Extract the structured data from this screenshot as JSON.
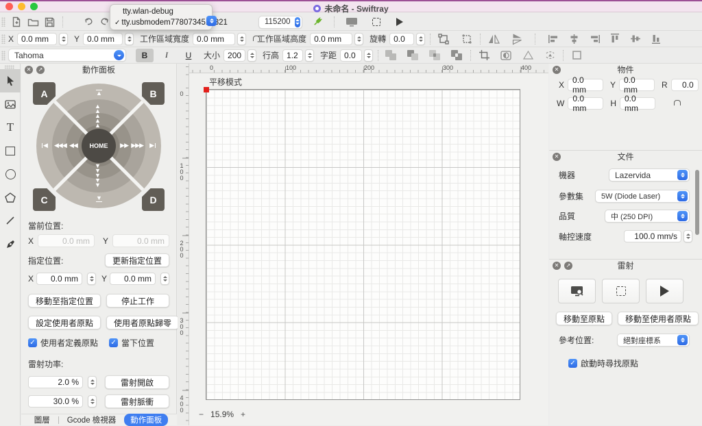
{
  "window": {
    "title": "未命名 - Swiftray"
  },
  "toolbar1": {
    "port_menu": {
      "item0": "tty.wlan-debug",
      "item1": "tty.usbmodem7780734518321",
      "check": "✓"
    },
    "baud": "115200"
  },
  "toolbar2": {
    "x_label": "X",
    "x_value": "0.0 mm",
    "y_label": "Y",
    "y_value": "0.0 mm",
    "width_label": "工作區域寬度",
    "width_value": "0.0 mm",
    "height_label": "工作區域高度",
    "height_value": "0.0 mm",
    "rotate_label": "旋轉",
    "rotate_value": "0.0"
  },
  "toolbar3": {
    "font_family": "Tahoma",
    "bold": "B",
    "italic": "I",
    "underline": "U",
    "size_label": "大小",
    "size_value": "200",
    "line_height_label": "行高",
    "line_height_value": "1.2",
    "letter_spacing_label": "字距",
    "letter_spacing_value": "0.0"
  },
  "action_panel": {
    "title": "動作面板",
    "jog": {
      "corner_a": "A",
      "corner_b": "B",
      "corner_c": "C",
      "corner_d": "D",
      "home": "HOME"
    },
    "current_position_label": "當前位置:",
    "x_label": "X",
    "y_label": "Y",
    "current_x": "0.0 mm",
    "current_y": "0.0 mm",
    "target_position_label": "指定位置:",
    "update_target_button": "更新指定位置",
    "target_x": "0.0 mm",
    "target_y": "0.0 mm",
    "move_to_target_button": "移動至指定位置",
    "stop_button": "停止工作",
    "set_user_origin_button": "設定使用者原點",
    "zero_user_origin_button": "使用者原點歸零",
    "user_origin_checkbox": "使用者定義原點",
    "current_pos_checkbox": "當下位置",
    "laser_power_label": "雷射功率:",
    "power_on_value": "2.0 %",
    "laser_on_button": "雷射開啟",
    "power_pulse_value": "30.0 %",
    "laser_pulse_button": "雷射脈衝",
    "check": "✓"
  },
  "bottom_tabs": {
    "layers": "圖層",
    "gcode": "Gcode 檢視器",
    "action": "動作面板"
  },
  "canvas": {
    "mode_label": "平移模式",
    "zoom_out": "−",
    "zoom_level": "15.9%",
    "zoom_in": "+",
    "h_ruler": [
      "0",
      "100",
      "200",
      "300",
      "400"
    ],
    "v_ruler": [
      "0",
      "100",
      "200",
      "300",
      "400"
    ]
  },
  "object_panel": {
    "title": "物件",
    "x_label": "X",
    "x": "0.0 mm",
    "y_label": "Y",
    "y": "0.0 mm",
    "r_label": "R",
    "r": "0.0",
    "w_label": "W",
    "w": "0.0 mm",
    "h_label": "H",
    "h": "0.0 mm"
  },
  "document_panel": {
    "title": "文件",
    "machine_label": "機器",
    "machine": "Lazervida",
    "preset_label": "參數集",
    "preset": "5W (Diode Laser)",
    "quality_label": "品質",
    "quality": "中 (250 DPI)",
    "speed_label": "軸控速度",
    "speed": "100.0 mm/s"
  },
  "laser_panel": {
    "title": "雷射",
    "move_to_origin_button": "移動至原點",
    "move_to_user_origin_button": "移動至使用者原點",
    "reference_label": "參考位置:",
    "reference": "絕對座標系",
    "home_on_start_checkbox": "啟動時尋找原點",
    "check": "✓"
  },
  "colors": {
    "accent": "#3f7ef0",
    "origin_marker": "#e3201b",
    "connected": "#6cb52d"
  }
}
